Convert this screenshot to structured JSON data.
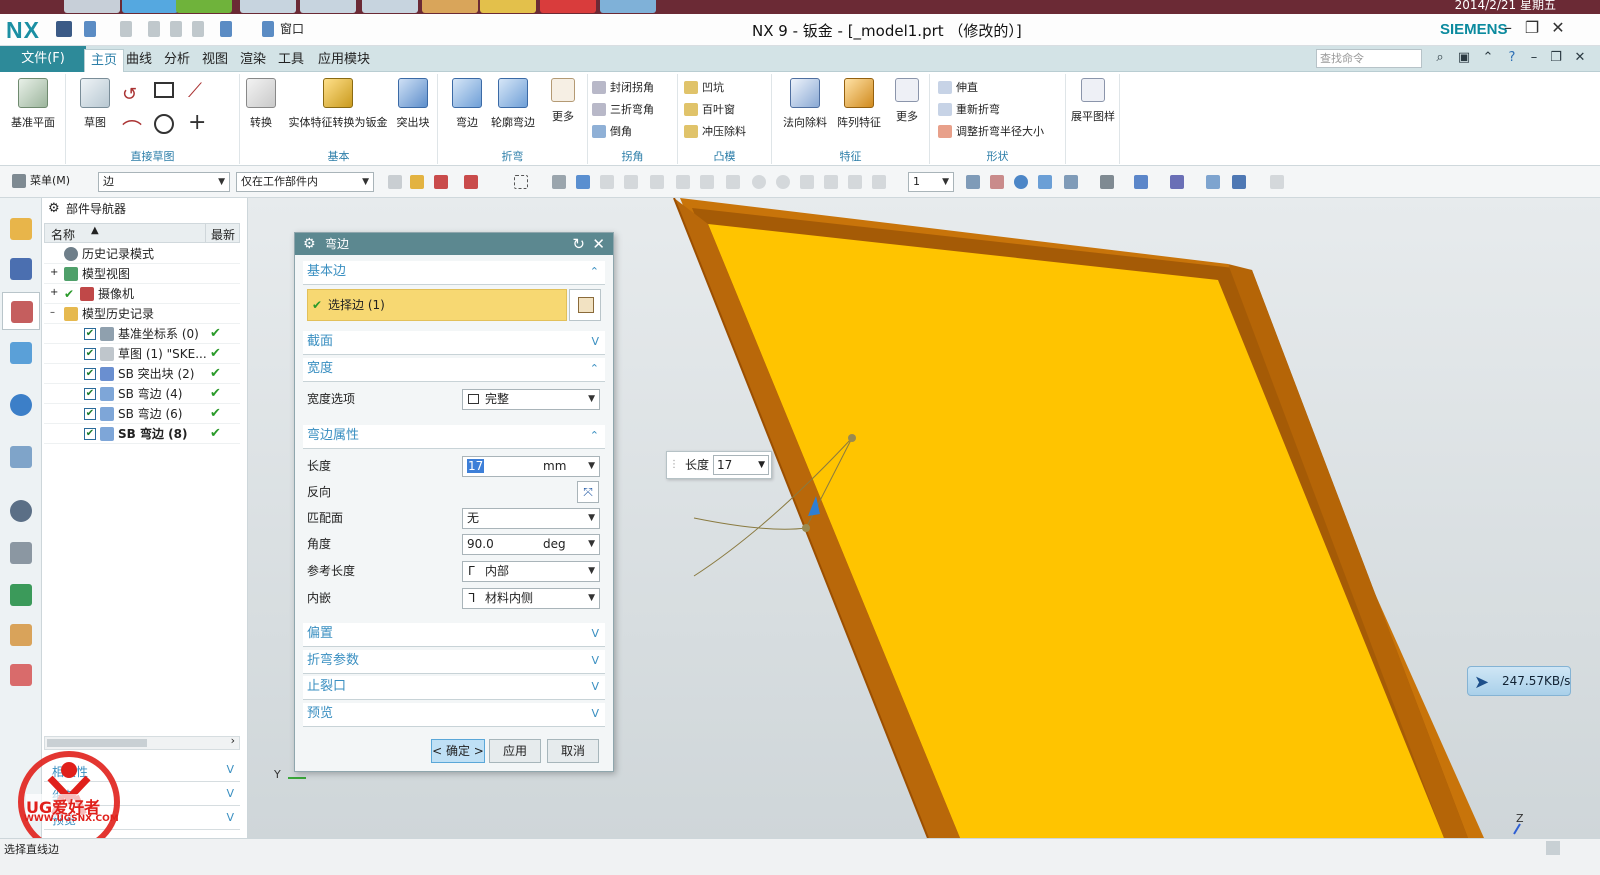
{
  "taskbar": {
    "clock": "2014/2/21 星期五"
  },
  "titlebar": {
    "logo": "NX",
    "title": "NX 9 - 钣金 - [_model1.prt （修改的）]",
    "brand": "SIEMENS",
    "window_menu": "窗口"
  },
  "menu": {
    "file": "文件(F)",
    "tabs": [
      "主页",
      "曲线",
      "分析",
      "视图",
      "渲染",
      "工具",
      "应用模块"
    ],
    "active_tab": "主页",
    "search_placeholder": "查找命令"
  },
  "ribbon": {
    "datum_plane": "基准平面",
    "sketch": "草图",
    "group_direct_sketch": "直接草图",
    "convert": "转换",
    "solid_to_sheet": "实体特征转换为钣金",
    "tab_feature": "突出块",
    "group_basic": "基本",
    "flange": "弯边",
    "contour_flange": "轮廓弯边",
    "more1": "更多",
    "group_fold": "折弯",
    "closed_corner": "封闭拐角",
    "three_bend_corner": "三折弯角",
    "chamfer": "倒角",
    "group_corner": "拐角",
    "dimple": "凹坑",
    "louver": "百叶窗",
    "punch_cutout": "冲压除料",
    "group_emboss": "凸模",
    "normal_cutout": "法向除料",
    "pattern_feature": "阵列特征",
    "more2": "更多",
    "group_feature": "特征",
    "unbend": "伸直",
    "rebend": "重新折弯",
    "resize_bend_radius": "调整折弯半径大小",
    "group_form": "形状",
    "flat_pattern": "展平图样"
  },
  "toolbar": {
    "menu": "菜单(M)",
    "selection_filter": "边",
    "scope": "仅在工作部件内",
    "count": "1"
  },
  "navigator": {
    "title": "部件导航器",
    "col_name": "名称",
    "col_latest": "最新",
    "items": [
      {
        "label": "历史记录模式",
        "checked": false,
        "latest": false
      },
      {
        "label": "模型视图",
        "checked": false,
        "latest": false
      },
      {
        "label": "摄像机",
        "checked": false,
        "latest": false
      },
      {
        "label": "模型历史记录",
        "checked": false,
        "latest": false
      },
      {
        "label": "基准坐标系 (0)",
        "checked": true,
        "latest": true
      },
      {
        "label": "草图 (1) \"SKE...",
        "checked": true,
        "latest": true
      },
      {
        "label": "SB 突出块 (2)",
        "checked": true,
        "latest": true
      },
      {
        "label": "SB 弯边 (4)",
        "checked": true,
        "latest": true
      },
      {
        "label": "SB 弯边 (6)",
        "checked": true,
        "latest": true
      },
      {
        "label": "SB 弯边 (8)",
        "checked": true,
        "latest": true
      }
    ],
    "panel_dependencies": "相关性",
    "panel_details": "细节",
    "panel_preview": "预览"
  },
  "dialog": {
    "title": "弯边",
    "sec_base_edge": "基本边",
    "select_edge": "选择边 (1)",
    "sec_section": "截面",
    "sec_width": "宽度",
    "width_option_label": "宽度选项",
    "width_option_value": "完整",
    "sec_flange_props": "弯边属性",
    "length_label": "长度",
    "length_value": "17",
    "length_unit": "mm",
    "reverse_label": "反向",
    "match_face_label": "匹配面",
    "match_face_value": "无",
    "angle_label": "角度",
    "angle_value": "90.0",
    "angle_unit": "deg",
    "ref_length_label": "参考长度",
    "ref_length_value": "内部",
    "inset_label": "内嵌",
    "inset_value": "材料内侧",
    "sec_offset": "偏置",
    "sec_bend_params": "折弯参数",
    "sec_relief": "止裂口",
    "sec_preview": "预览",
    "ok": "< 确定 >",
    "apply": "应用",
    "cancel": "取消"
  },
  "viewport": {
    "length_popup_label": "长度",
    "length_popup_value": "17",
    "speed": "247.57KB/s",
    "axis_y": "Y",
    "axis_z": "Z"
  },
  "statusbar": {
    "message": "选择直线边"
  },
  "watermark": {
    "text": "UG爱好者",
    "url": "WWW.UGSNX.COM"
  },
  "colors": {
    "accent": "#2d8a99",
    "part_face": "#ffc400",
    "part_edge": "#c8740a",
    "selection": "#f7d872"
  }
}
